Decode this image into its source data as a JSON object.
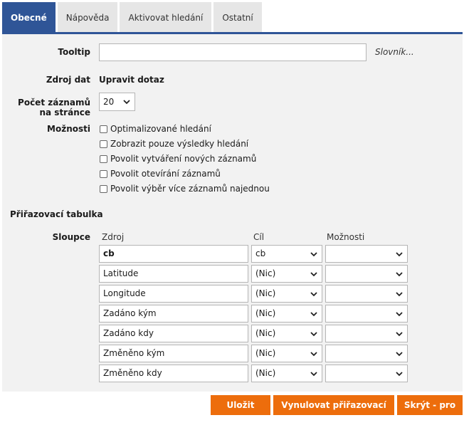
{
  "tabs": [
    "Obecné",
    "Nápověda",
    "Aktivovat hledání",
    "Ostatní"
  ],
  "form": {
    "tooltip_label": "Tooltip",
    "tooltip_value": "",
    "dictionary_link": "Slovník...",
    "data_source_label": "Zdroj dat",
    "data_source_value": "Upravit dotaz",
    "page_size_label_line1": "Počet záznamů",
    "page_size_label_line2": "na stránce",
    "page_size_value": "20",
    "options_label": "Možnosti",
    "options": [
      {
        "label": "Optimalizované hledání",
        "checked": false
      },
      {
        "label": "Zobrazit pouze výsledky hledání",
        "checked": false
      },
      {
        "label": "Povolit vytváření nových záznamů",
        "checked": false
      },
      {
        "label": "Povolit otevírání záznamů",
        "checked": false
      },
      {
        "label": "Povolit výběr více záznamů najednou",
        "checked": false
      }
    ]
  },
  "mapping": {
    "section_title": "Přiřazovací tabulka",
    "columns_label": "Sloupce",
    "headers": {
      "source": "Zdroj",
      "target": "Cíl",
      "options": "Možnosti"
    },
    "rows": [
      {
        "source": "cb",
        "target": "cb",
        "options": ""
      },
      {
        "source": "Latitude",
        "target": "(Nic)",
        "options": ""
      },
      {
        "source": "Longitude",
        "target": "(Nic)",
        "options": ""
      },
      {
        "source": "Zadáno kým",
        "target": "(Nic)",
        "options": ""
      },
      {
        "source": "Zadáno kdy",
        "target": "(Nic)",
        "options": ""
      },
      {
        "source": "Změněno kým",
        "target": "(Nic)",
        "options": ""
      },
      {
        "source": "Změněno kdy",
        "target": "(Nic)",
        "options": ""
      }
    ]
  },
  "buttons": {
    "save": "Uložit",
    "reset_mapping": "Vynulovat přiřazovací tabulku",
    "hide_all": "Skrýt - pro vše"
  },
  "colors": {
    "accent": "#2f5597",
    "action": "#ed6d0c",
    "panel": "#f2f2f2"
  }
}
